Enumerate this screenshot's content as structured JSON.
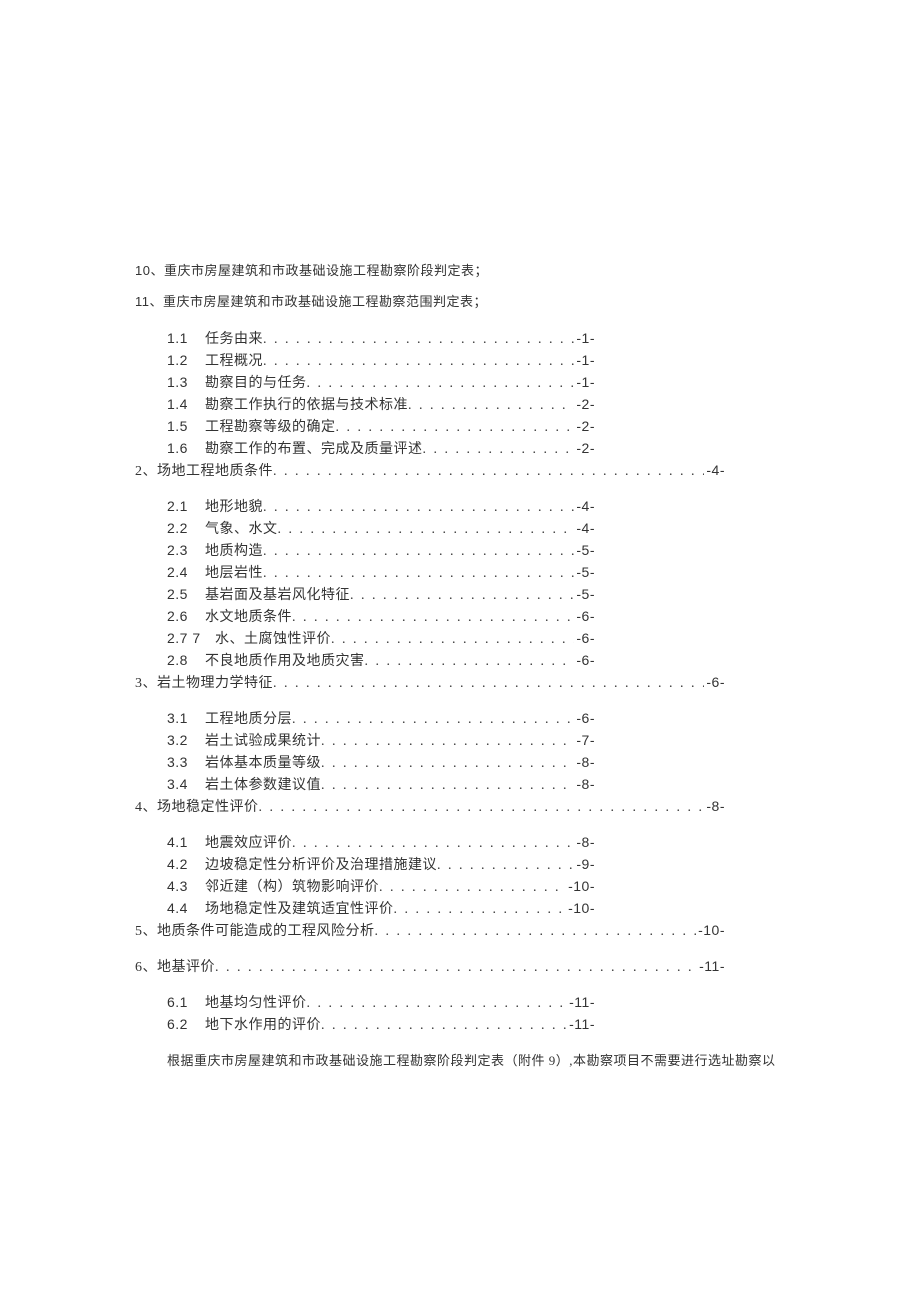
{
  "intro": [
    {
      "num": "10、",
      "text": "重庆市房屋建筑和市政基础设施工程勘察阶段判定表；"
    },
    {
      "num": "11、",
      "text": "重庆市房屋建筑和市政基础设施工程勘察范围判定表；"
    }
  ],
  "toc": [
    {
      "type": "group",
      "items": [
        {
          "num": "1.1",
          "title": "任务由来",
          "page": "-1-"
        },
        {
          "num": "1.2",
          "title": "工程概况",
          "page": "-1-"
        },
        {
          "num": "1.3",
          "title": "勘察目的与任务",
          "page": "-1-"
        },
        {
          "num": "1.4",
          "title": "勘察工作执行的依据与技术标准",
          "page": "-2-"
        },
        {
          "num": "1.5",
          "title": "工程勘察等级的确定",
          "page": "-2-"
        },
        {
          "num": "1.6",
          "title": "勘察工作的布置、完成及质量评述",
          "page": "-2-"
        }
      ],
      "section": {
        "num": "2、",
        "title": "场地工程地质条件",
        "page": "-4-"
      }
    },
    {
      "type": "group",
      "items": [
        {
          "num": "2.1",
          "title": "地形地貌",
          "page": "-4-"
        },
        {
          "num": "2.2",
          "title": "气象、水文",
          "page": "-4-"
        },
        {
          "num": "2.3",
          "title": "地质构造",
          "page": "-5-"
        },
        {
          "num": "2.4",
          "title": "地层岩性",
          "page": "-5-"
        },
        {
          "num": "2.5",
          "title": "基岩面及基岩风化特征",
          "page": "-5-"
        },
        {
          "num": "2.6",
          "title": "水文地质条件",
          "page": "-6-"
        },
        {
          "num": "2.7 7",
          "title": "水、土腐蚀性评价",
          "page": "-6-",
          "wide": true
        },
        {
          "num": "2.8",
          "title": "不良地质作用及地质灾害",
          "page": "-6-"
        }
      ],
      "section": {
        "num": "3、",
        "title": "岩土物理力学特征",
        "page": "-6-"
      }
    },
    {
      "type": "group",
      "items": [
        {
          "num": "3.1",
          "title": "工程地质分层",
          "page": "-6-"
        },
        {
          "num": "3.2",
          "title": "岩土试验成果统计",
          "page": "-7-"
        },
        {
          "num": "3.3",
          "title": "岩体基本质量等级",
          "page": "-8-"
        },
        {
          "num": "3.4",
          "title": "岩土体参数建议值",
          "page": "-8-"
        }
      ],
      "section": {
        "num": "4、",
        "title": "场地稳定性评价",
        "page": "-8-"
      }
    },
    {
      "type": "group",
      "items": [
        {
          "num": "4.1",
          "title": "地震效应评价",
          "page": "-8-"
        },
        {
          "num": "4.2",
          "title": "边坡稳定性分析评价及治理措施建议",
          "page": "-9-"
        },
        {
          "num": "4.3",
          "title": "邻近建（构）筑物影响评价",
          "page": "-10-"
        },
        {
          "num": "4.4",
          "title": "场地稳定性及建筑适宜性评价",
          "page": "-10-"
        }
      ],
      "section": {
        "num": "5、",
        "title": "地质条件可能造成的工程风险分析",
        "page": "-10-"
      }
    },
    {
      "type": "group",
      "items": [],
      "section": {
        "num": "6、",
        "title": "地基评价",
        "page": "-11-"
      }
    },
    {
      "type": "group",
      "items": [
        {
          "num": "6.1",
          "title": "地基均匀性评价",
          "page": "-11-"
        },
        {
          "num": "6.2",
          "title": "地下水作用的评价",
          "page": "-11-"
        }
      ]
    }
  ],
  "footnote": "根据重庆市房屋建筑和市政基础设施工程勘察阶段判定表（附件 9）,本勘察项目不需要进行选址勘察以"
}
